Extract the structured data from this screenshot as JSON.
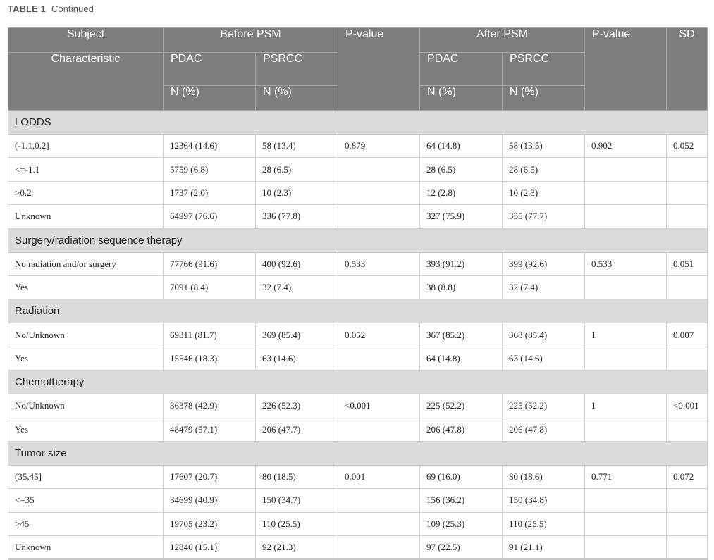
{
  "caption": {
    "label": "TABLE 1",
    "text": "Continued"
  },
  "header": {
    "subject": "Subject",
    "characteristic": "Characteristic",
    "before_psm": "Before PSM",
    "pvalue_1": "P-value",
    "after_psm": "After PSM",
    "pvalue_2": "P-value",
    "sd": "SD",
    "pdac_1": "PDAC",
    "psrcc_1": "PSRCC",
    "pdac_2": "PDAC",
    "psrcc_2": "PSRCC",
    "n_1": "N (%)",
    "n_2": "N (%)",
    "n_3": "N (%)",
    "n_4": "N (%)"
  },
  "groups": [
    {
      "title": "LODDS",
      "rows": [
        [
          "(-1.1,0.2]",
          "12364 (14.6)",
          "58 (13.4)",
          "0.879",
          "64 (14.8)",
          "58 (13.5)",
          "0.902",
          "0.052"
        ],
        [
          "<=-1.1",
          "5759 (6.8)",
          "28 (6.5)",
          "",
          "28 (6.5)",
          "28 (6.5)",
          "",
          ""
        ],
        [
          ">0.2",
          "1737 (2.0)",
          "10 (2.3)",
          "",
          "12 (2.8)",
          "10 (2.3)",
          "",
          ""
        ],
        [
          "Unknown",
          "64997 (76.6)",
          "336 (77.8)",
          "",
          "327 (75.9)",
          "335 (77.7)",
          "",
          ""
        ]
      ]
    },
    {
      "title": "Surgery/radiation sequence therapy",
      "rows": [
        [
          "No radiation and/or surgery",
          "77766 (91.6)",
          "400 (92.6)",
          "0.533",
          "393 (91.2)",
          "399 (92.6)",
          "0.533",
          "0.051"
        ],
        [
          "Yes",
          "7091 (8.4)",
          "32 (7.4)",
          "",
          "38 (8.8)",
          "32 (7.4)",
          "",
          ""
        ]
      ]
    },
    {
      "title": "Radiation",
      "rows": [
        [
          "No/Unknown",
          "69311 (81.7)",
          "369 (85.4)",
          "0.052",
          "367 (85.2)",
          "368 (85.4)",
          "1",
          "0.007"
        ],
        [
          "Yes",
          "15546 (18.3)",
          "63 (14.6)",
          "",
          "64 (14.8)",
          "63 (14.6)",
          "",
          ""
        ]
      ]
    },
    {
      "title": "Chemotherapy",
      "rows": [
        [
          "No/Unknown",
          "36378 (42.9)",
          "226 (52.3)",
          "<0.001",
          "225 (52.2)",
          "225 (52.2)",
          "1",
          "<0.001"
        ],
        [
          "Yes",
          "48479 (57.1)",
          "206 (47.7)",
          "",
          "206 (47.8)",
          "206 (47.8)",
          "",
          ""
        ]
      ]
    },
    {
      "title": "Tumor size",
      "rows": [
        [
          "(35,45]",
          "17607 (20.7)",
          "80 (18.5)",
          "0.001",
          "69 (16.0)",
          "80 (18.6)",
          "0.771",
          "0.072"
        ],
        [
          "<=35",
          "34699 (40.9)",
          "150 (34.7)",
          "",
          "156 (36.2)",
          "150 (34.8)",
          "",
          ""
        ],
        [
          ">45",
          "19705 (23.2)",
          "110 (25.5)",
          "",
          "109 (25.3)",
          "110 (25.5)",
          "",
          ""
        ],
        [
          "Unknown",
          "12846 (15.1)",
          "92 (21.3)",
          "",
          "97 (22.5)",
          "91 (21.1)",
          "",
          ""
        ]
      ]
    }
  ]
}
